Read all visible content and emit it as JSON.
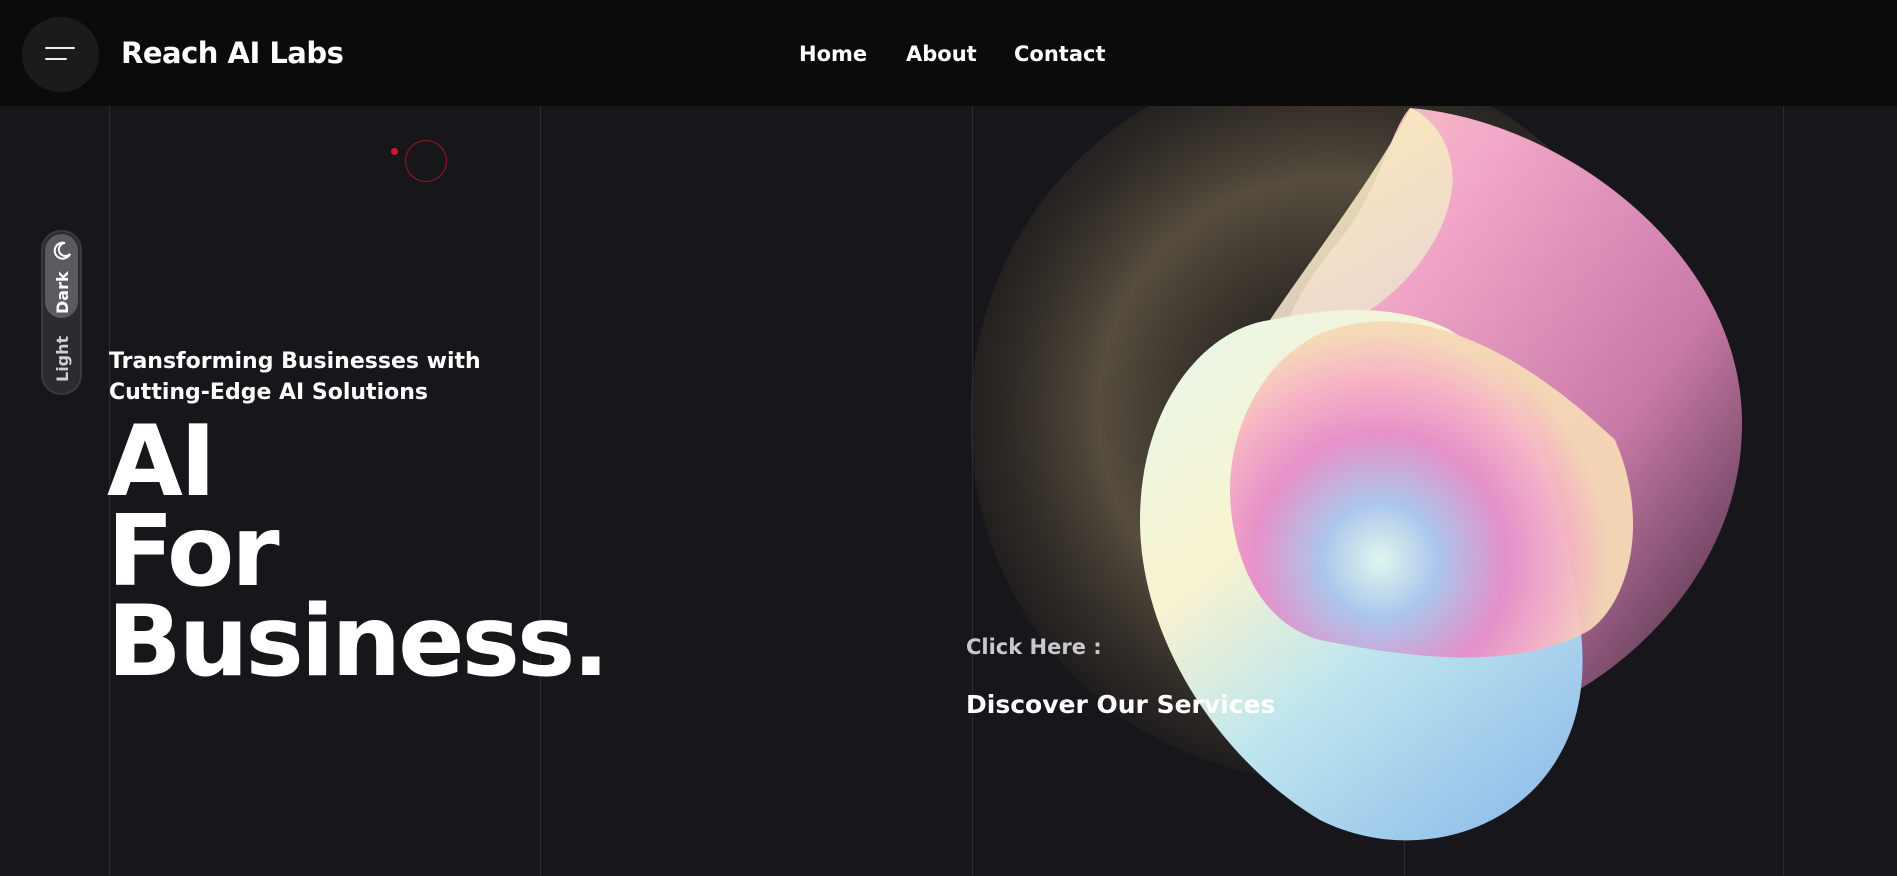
{
  "header": {
    "brand": "Reach AI Labs",
    "nav": [
      {
        "label": "Home"
      },
      {
        "label": "About"
      },
      {
        "label": "Contact"
      }
    ]
  },
  "theme_toggle": {
    "dark_label": "Dark",
    "light_label": "Light",
    "selected": "Dark"
  },
  "hero": {
    "tagline_line1": "Transforming Businesses with",
    "tagline_line2": "Cutting-Edge AI Solutions",
    "headline_lines": [
      "AI",
      "For",
      "Business."
    ]
  },
  "cta": {
    "prompt": "Click Here :",
    "link_label": "Discover Our Services"
  },
  "colors": {
    "background": "#17161b",
    "header": "#0b0b0b",
    "accent": "#e0132f"
  }
}
